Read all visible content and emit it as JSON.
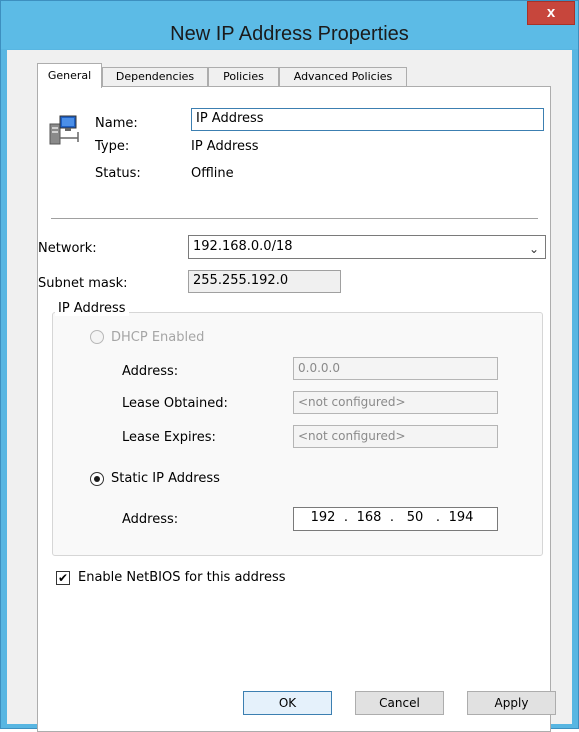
{
  "window": {
    "title": "New IP Address Properties",
    "close_label": "x"
  },
  "tabs": [
    {
      "label": "General"
    },
    {
      "label": "Dependencies"
    },
    {
      "label": "Policies"
    },
    {
      "label": "Advanced Policies"
    }
  ],
  "resource": {
    "name_label": "Name:",
    "name_value": "IP Address",
    "type_label": "Type:",
    "type_value": "IP Address",
    "status_label": "Status:",
    "status_value": "Offline",
    "icon": "server-network-icon"
  },
  "network": {
    "network_label": "Network:",
    "network_value": "192.168.0.0/18",
    "subnet_label": "Subnet mask:",
    "subnet_value": "255.255.192.0"
  },
  "ip_group": {
    "title": "IP Address",
    "dhcp_label": "DHCP Enabled",
    "dhcp_address_label": "Address:",
    "dhcp_address_value": "0.0.0.0",
    "lease_obtained_label": "Lease Obtained:",
    "lease_obtained_value": "<not configured>",
    "lease_expires_label": "Lease Expires:",
    "lease_expires_value": "<not configured>",
    "static_label": "Static IP Address",
    "static_address_label": "Address:",
    "static_octets": [
      "192",
      "168",
      "50",
      "194"
    ],
    "octet_separator": "."
  },
  "netbios": {
    "label": "Enable NetBIOS for this address",
    "checked": true,
    "check_glyph": "✔"
  },
  "buttons": {
    "ok": "OK",
    "cancel": "Cancel",
    "apply": "Apply"
  },
  "colors": {
    "titlebar": "#5cbbe6",
    "close_button": "#c7463c",
    "focus_border": "#3c7fb1"
  }
}
